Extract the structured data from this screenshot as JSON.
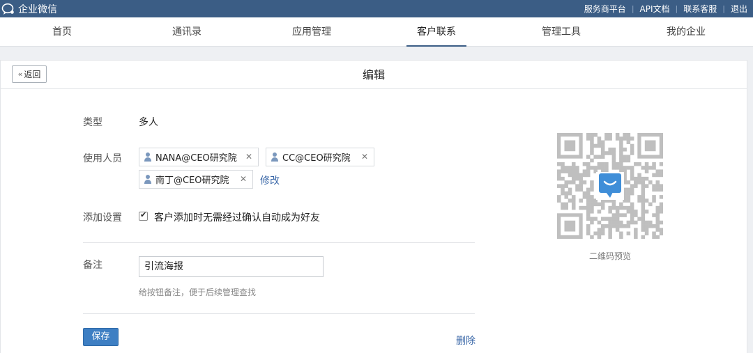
{
  "topbar": {
    "brand": "企业微信",
    "links": [
      "服务商平台",
      "API文档",
      "联系客服",
      "退出"
    ]
  },
  "nav": {
    "tabs": [
      {
        "label": "首页"
      },
      {
        "label": "通讯录"
      },
      {
        "label": "应用管理"
      },
      {
        "label": "客户联系",
        "active": true
      },
      {
        "label": "管理工具"
      },
      {
        "label": "我的企业"
      }
    ]
  },
  "panel": {
    "back_label": "返回",
    "title": "编辑"
  },
  "form": {
    "type_label": "类型",
    "type_value": "多人",
    "users_label": "使用人员",
    "users": [
      "NANA@CEO研究院",
      "CC@CEO研究院",
      "南丁@CEO研究院"
    ],
    "modify_link": "修改",
    "add_settings_label": "添加设置",
    "auto_accept_checked": true,
    "auto_accept_label": "客户添加时无需经过确认自动成为好友",
    "note_label": "备注",
    "note_value": "引流海报",
    "note_hint": "给按钮备注，便于后续管理查找",
    "save_label": "保存",
    "delete_label": "删除"
  },
  "qr": {
    "caption": "二维码预览"
  },
  "colors": {
    "topbar": "#3b5d85",
    "accent": "#3e7fc3",
    "link": "#3b68a8"
  }
}
